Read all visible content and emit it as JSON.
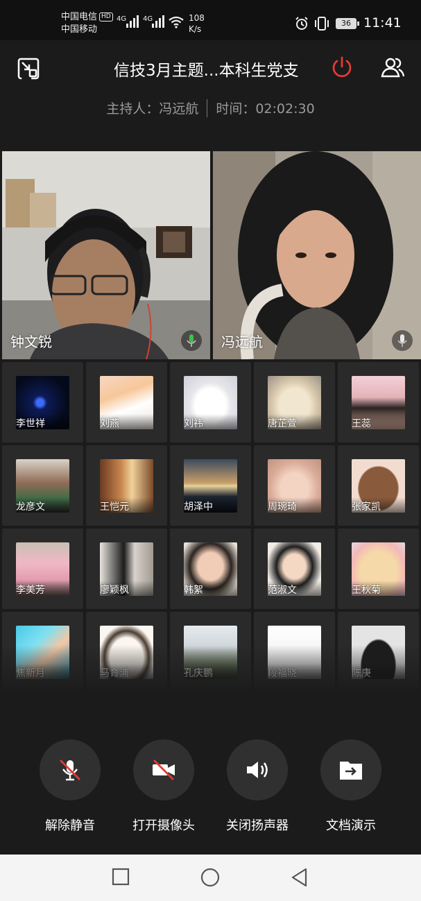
{
  "status_bar": {
    "carrier1": "中国电信",
    "carrier1_badge": "HD",
    "carrier2": "中国移动",
    "net1": "4G",
    "net2": "4G",
    "speed_value": "108",
    "speed_unit": "K/s",
    "battery": "36",
    "time": "11:41"
  },
  "header": {
    "title": "信技3月主题...本科生党支",
    "host_label": "主持人：冯远航",
    "time_label": "时间：02:02:30"
  },
  "videos": [
    {
      "name": "钟文锐",
      "icon": "mic-active-icon"
    },
    {
      "name": "冯远航",
      "icon": "mic-icon"
    }
  ],
  "participants": [
    {
      "name": "李世祥"
    },
    {
      "name": "刘燕"
    },
    {
      "name": "刘祎"
    },
    {
      "name": "唐芷萱"
    },
    {
      "name": "王蕊"
    },
    {
      "name": "龙彦文"
    },
    {
      "name": "王恺元"
    },
    {
      "name": "胡泽中"
    },
    {
      "name": "周琬琦"
    },
    {
      "name": "张家凯"
    },
    {
      "name": "李美芳"
    },
    {
      "name": "廖颖枫"
    },
    {
      "name": "韩絮"
    },
    {
      "name": "范淑文"
    },
    {
      "name": "王秋菊"
    },
    {
      "name": "焦新月"
    },
    {
      "name": "马育浦"
    },
    {
      "name": "孔庆鹏"
    },
    {
      "name": "段福晓"
    },
    {
      "name": "陈庚"
    }
  ],
  "controls": {
    "unmute": "解除静音",
    "camera": "打开摄像头",
    "speaker": "关闭扬声器",
    "share": "文档演示"
  },
  "colors": {
    "accent_red": "#e53935",
    "mic_green": "#3fbf4a",
    "background": "#1b1b1b",
    "cell": "#2a2a2a"
  }
}
